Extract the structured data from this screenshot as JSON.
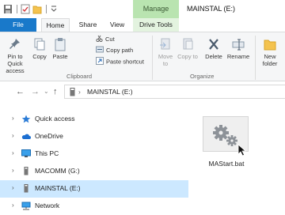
{
  "window": {
    "contextual_tab": "Manage",
    "title": "MAINSTAL (E:)"
  },
  "ribbon_tabs": [
    "File",
    "Home",
    "Share",
    "View",
    "Drive Tools"
  ],
  "clipboard": {
    "pin": "Pin to Quick access",
    "copy": "Copy",
    "paste": "Paste",
    "cut": "Cut",
    "copy_path": "Copy path",
    "paste_shortcut": "Paste shortcut",
    "group": "Clipboard"
  },
  "organize": {
    "move_to": "Move to",
    "copy_to": "Copy to",
    "delete": "Delete",
    "rename": "Rename",
    "group": "Organize"
  },
  "new": {
    "new_folder": "New folder"
  },
  "address": {
    "location": "MAINSTAL (E:)"
  },
  "nav_pane": [
    {
      "label": "Quick access",
      "icon": "star-icon"
    },
    {
      "label": "OneDrive",
      "icon": "cloud-icon"
    },
    {
      "label": "This PC",
      "icon": "monitor-icon"
    },
    {
      "label": "MACOMM (G:)",
      "icon": "usb-drive-icon"
    },
    {
      "label": "MAINSTAL (E:)",
      "icon": "usb-drive-icon",
      "selected": true
    },
    {
      "label": "Network",
      "icon": "network-icon"
    }
  ],
  "files": [
    {
      "name": "MAStart.bat",
      "icon": "batch-file-gears-icon"
    }
  ],
  "colors": {
    "file_tab": "#1979ca",
    "manage_tab": "#b9e4b0",
    "selection": "#cce8ff"
  }
}
